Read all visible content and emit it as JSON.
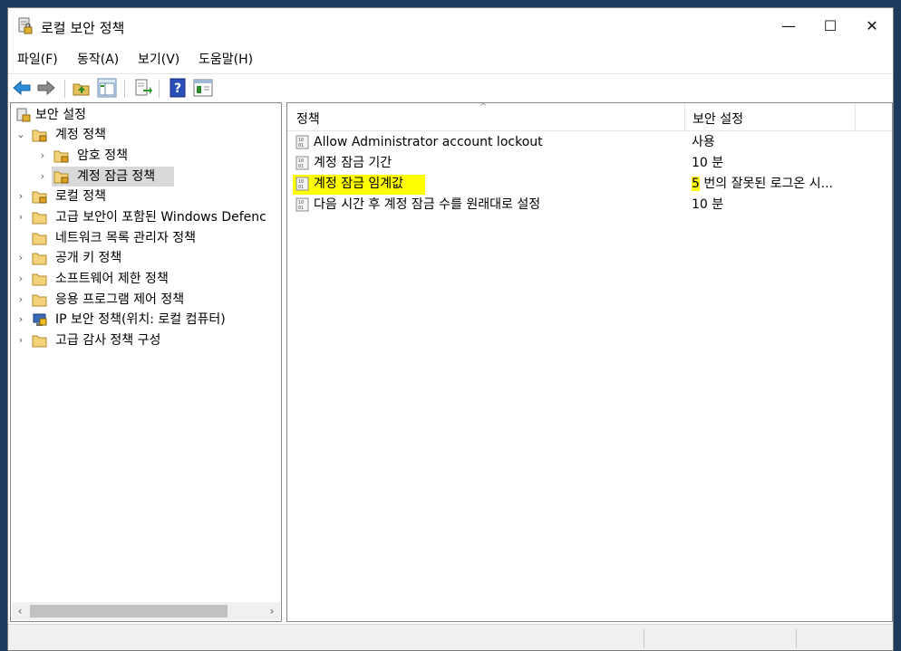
{
  "window": {
    "title": "로컬 보안 정책"
  },
  "controls": {
    "minimize": "—",
    "maximize": "☐",
    "close": "✕"
  },
  "menu": [
    "파일(F)",
    "동작(A)",
    "보기(V)",
    "도움말(H)"
  ],
  "toolbar": [
    "back-icon",
    "forward-icon",
    "up-folder-icon",
    "show-hide-tree-icon",
    "export-list-icon",
    "help-icon",
    "console-view-icon"
  ],
  "tree": {
    "root": "보안 설정",
    "items": [
      {
        "label": "계정 정책",
        "expander": "⌄"
      },
      {
        "label": "암호 정책",
        "expander": "›"
      },
      {
        "label": "계정 잠금 정책",
        "expander": "›"
      },
      {
        "label": "로컬 정책",
        "expander": "›"
      },
      {
        "label": "고급 보안이 포함된 Windows Defenc",
        "expander": "›"
      },
      {
        "label": "네트워크 목록 관리자 정책",
        "expander": ""
      },
      {
        "label": "공개 키 정책",
        "expander": "›"
      },
      {
        "label": "소프트웨어 제한 정책",
        "expander": "›"
      },
      {
        "label": "응용 프로그램 제어 정책",
        "expander": "›"
      },
      {
        "label": "IP 보안 정책(위치: 로컬 컴퓨터)",
        "expander": "›"
      },
      {
        "label": "고급 감사 정책 구성",
        "expander": "›"
      }
    ],
    "scroll_left": "‹",
    "scroll_right": "›"
  },
  "list": {
    "columns": {
      "policy": "정책",
      "setting": "보안 설정"
    },
    "sort_indicator": "^",
    "rows": [
      {
        "name": "Allow Administrator account lockout",
        "value": "사용"
      },
      {
        "name": "계정 잠금 기간",
        "value": "10 분"
      },
      {
        "name": "계정 잠금 임계값",
        "value_highlight": "5",
        "value_rest": " 번의 잘못된 로그온 시..."
      },
      {
        "name": "다음 시간 후 계정 잠금 수를 원래대로 설정",
        "value": "10 분"
      }
    ]
  },
  "colors": {
    "highlight": "#ffff00",
    "tree_selection": "#d9d9d9",
    "desktop": "#1b3a5c"
  }
}
